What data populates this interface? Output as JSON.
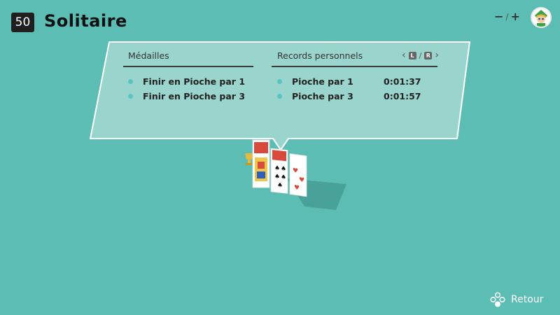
{
  "header": {
    "number": "50",
    "title": "Solitaire",
    "zoom_minus": "−",
    "zoom_sep": "/",
    "zoom_plus": "+"
  },
  "panel": {
    "medals_header": "Médailles",
    "records_header": "Records personnels",
    "nav_left_key": "L",
    "nav_sep": "/",
    "nav_right_key": "R",
    "medals": [
      {
        "label": "Finir en Pioche par 1"
      },
      {
        "label": "Finir en Pioche par 3"
      }
    ],
    "records": [
      {
        "label": "Pioche par 1",
        "time": "0:01:37"
      },
      {
        "label": "Pioche par 3",
        "time": "0:01:57"
      }
    ]
  },
  "footer": {
    "back_label": "Retour"
  },
  "colors": {
    "background": "#5bbdb3",
    "panel_fill": "#9ed6cf",
    "bullet": "#58c5c0",
    "card_red": "#d94a3d"
  }
}
